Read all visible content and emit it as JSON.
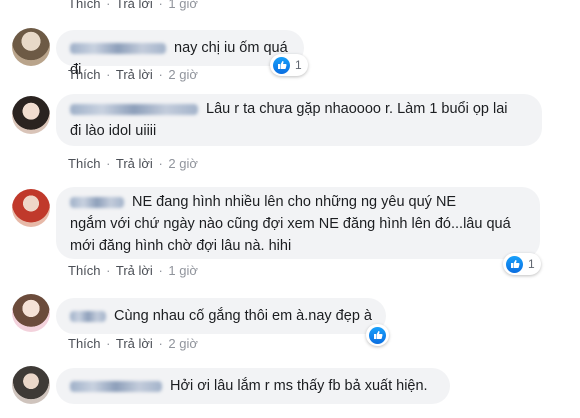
{
  "comments": [
    {
      "text_lines": [],
      "actions": {
        "like": "Thích",
        "reply": "Trả lời",
        "time": "1 giờ"
      }
    },
    {
      "text_lines": [
        "nay chị iu ốm quá đi"
      ],
      "actions": {
        "like": "Thích",
        "reply": "Trả lời",
        "time": "2 giờ"
      },
      "reaction_count": "1"
    },
    {
      "text_lines": [
        "Lâu r ta chưa gặp nhaoooo r. Làm 1 buổi ọp lai",
        "đi lào idol uiiii"
      ],
      "actions": {
        "like": "Thích",
        "reply": "Trả lời",
        "time": "2 giờ"
      }
    },
    {
      "text_lines": [
        "NE đang hình nhiều lên cho những ng yêu quý NE",
        "ngắm với chứ ngày nào cũng đợi xem NE đăng hình lên đó...lâu quá",
        "mới đăng hình chờ đợi lâu nà. hihi"
      ],
      "actions": {
        "like": "Thích",
        "reply": "Trả lời",
        "time": "1 giờ"
      },
      "reaction_count": "1"
    },
    {
      "text_lines": [
        "Cùng nhau cố gắng thôi em à.nay đẹp à"
      ],
      "actions": {
        "like": "Thích",
        "reply": "Trả lời",
        "time": "2 giờ"
      },
      "reaction_count": ""
    },
    {
      "text_lines": [
        "Hởi ơi lâu lắm r ms thấy fb bả xuất hiện."
      ],
      "actions": {}
    }
  ],
  "icons": {
    "avatar": "user-avatar",
    "reaction": "like-icon"
  },
  "colors": {
    "bubble": "#f2f3f5",
    "link": "#4b4f56",
    "meta": "#90949c",
    "like_blue": "#1877f2"
  }
}
